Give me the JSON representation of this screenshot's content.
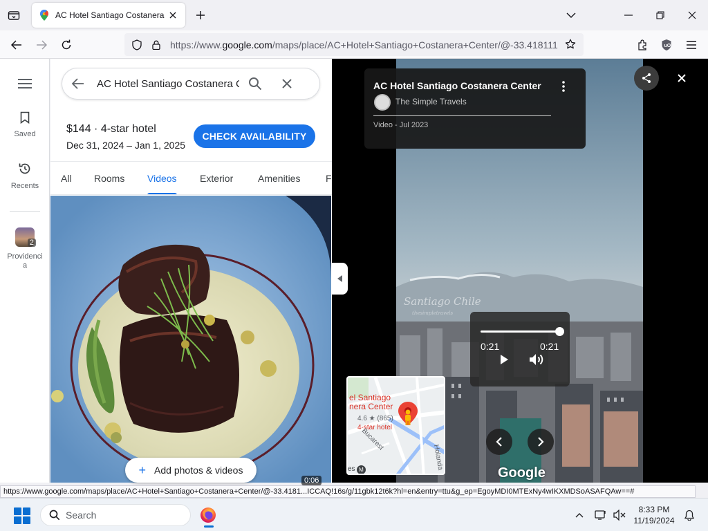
{
  "browser": {
    "tab_title": "AC Hotel Santiago Costanera C",
    "url_prefix": "https://www.",
    "url_domain": "google.com",
    "url_rest": "/maps/place/AC+Hotel+Santiago+Costanera+Center/@-33.418111",
    "status_url": "https://www.google.com/maps/place/AC+Hotel+Santiago+Costanera+Center/@-33.4181...ICCAQ!16s/g/11gbk12t6k?hl=en&entry=ttu&g_ep=EgoyMDI0MTExNy4wIKXMDSoASAFQAw==#"
  },
  "rail": {
    "saved_label": "Saved",
    "recents_label": "Recents",
    "recent_place_label": "Providencia",
    "recent_place_count": "2"
  },
  "panel": {
    "search_value": "AC Hotel Santiago Costanera C",
    "price_line": "$144 · 4-star hotel",
    "date_line": "Dec 31, 2024 – Jan 1, 2025",
    "check_button": "CHECK AVAILABILITY",
    "tabs": [
      "All",
      "Rooms",
      "Videos",
      "Exterior",
      "Amenities",
      "F"
    ],
    "active_tab": "Videos",
    "add_button": "Add photos & videos",
    "duration_badge": "0:06"
  },
  "viewer": {
    "title": "AC Hotel Santiago Costanera Center",
    "author": "The Simple Travels",
    "date": "Video - Jul 2023",
    "time_current": "0:21",
    "time_total": "0:21",
    "progress_fraction": 1.0,
    "watermark": "Santiago Chile",
    "watermark_sub": "thesimpletravels",
    "map_name_line1": "el Santiago",
    "map_name_line2": "nera Center",
    "map_rating": "4.6 ★ (865)",
    "map_type": "4-star hotel",
    "map_street1": "Bucarest",
    "map_street2": "Holanda",
    "map_es": "es",
    "map_metro": "M",
    "logo": "Google"
  },
  "taskbar": {
    "search_placeholder": "Search",
    "time": "8:33 PM",
    "date": "11/19/2024"
  },
  "colors": {
    "accent": "#1a73e8",
    "viewer_bg": "#000000",
    "map_pin": "#ea4335"
  }
}
